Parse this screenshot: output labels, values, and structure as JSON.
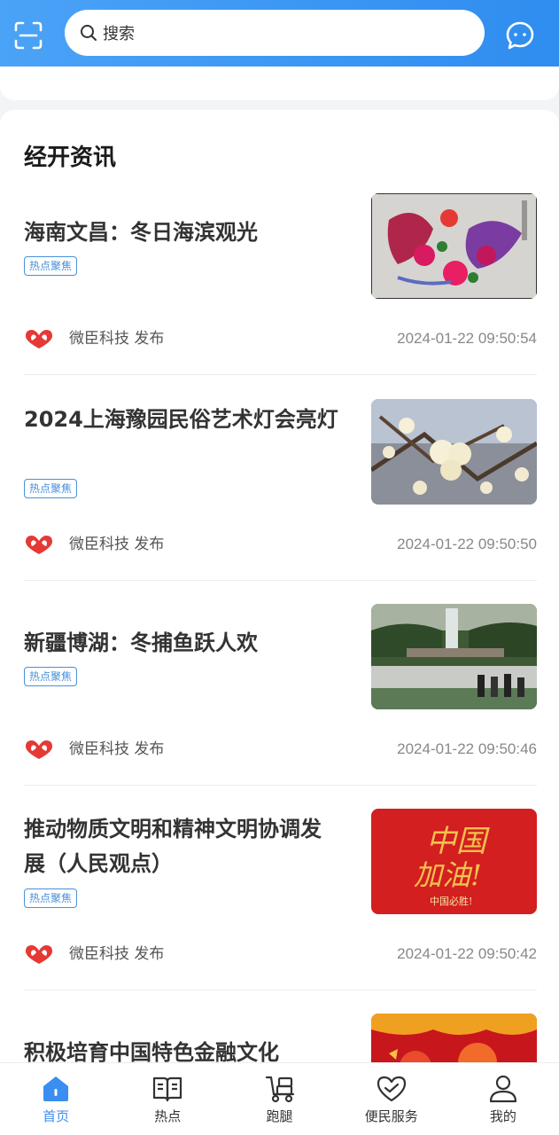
{
  "header": {
    "search_placeholder": "搜索"
  },
  "section": {
    "title": "经开资讯"
  },
  "news": [
    {
      "title": "海南文昌：冬日海滨观光",
      "tag": "热点聚焦",
      "publisher": "微臣科技 发布",
      "time": "2024-01-22 09:50:54",
      "image": "paper-cut phoenix and peony artwork"
    },
    {
      "title": "2024上海豫园民俗艺术灯会亮灯",
      "tag": "热点聚焦",
      "publisher": "微臣科技 发布",
      "time": "2024-01-22 09:50:50",
      "image": "white plum blossoms"
    },
    {
      "title": "新疆博湖：冬捕鱼跃人欢",
      "tag": "热点聚焦",
      "publisher": "微臣科技 发布",
      "time": "2024-01-22 09:50:46",
      "image": "waterfall scenery with visitors"
    },
    {
      "title": "推动物质文明和精神文明协调发展（人民观点）",
      "tag": "热点聚焦",
      "publisher": "微臣科技 发布",
      "time": "2024-01-22 09:50:42",
      "image": "red poster with gold calligraphy",
      "image_text": {
        "line1": "中国",
        "line2": "加油!",
        "line3": "中国必胜!"
      }
    },
    {
      "title": "积极培育中国特色金融文化",
      "image": "red festive banner"
    }
  ],
  "tabbar": [
    {
      "label": "首页",
      "icon": "home-icon",
      "active": true
    },
    {
      "label": "热点",
      "icon": "book-icon",
      "active": false
    },
    {
      "label": "跑腿",
      "icon": "delivery-icon",
      "active": false
    },
    {
      "label": "便民服务",
      "icon": "heart-hand-icon",
      "active": false
    },
    {
      "label": "我的",
      "icon": "user-icon",
      "active": false
    }
  ],
  "colors": {
    "header_gradient_start": "#4ba3f7",
    "header_gradient_end": "#2f8df0",
    "accent": "#3a8ef0",
    "tag_blue": "#4a90d9",
    "logo_red": "#e53935"
  }
}
